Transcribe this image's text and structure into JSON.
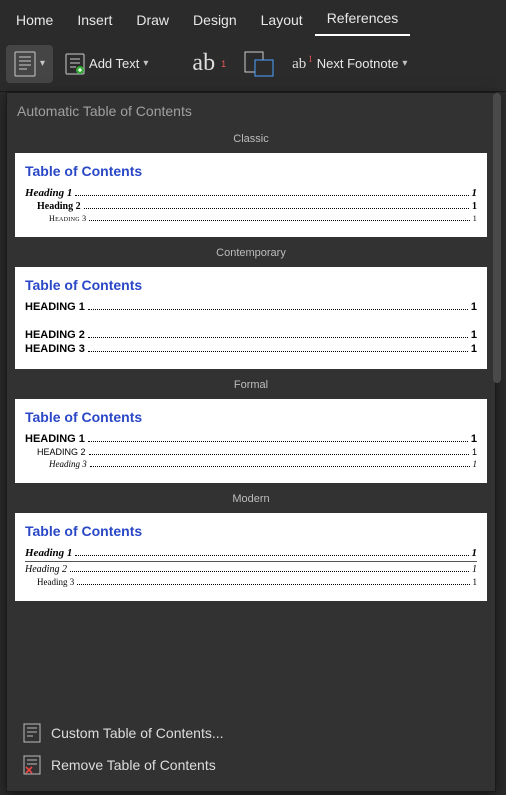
{
  "tabs": [
    "Home",
    "Insert",
    "Draw",
    "Design",
    "Layout",
    "References"
  ],
  "activeTab": "References",
  "ribbon": {
    "addText": "Add Text",
    "nextFootnote": "Next Footnote"
  },
  "dropdown": {
    "header": "Automatic Table of Contents",
    "styles": [
      {
        "name": "Classic",
        "title": "Table of Contents",
        "rows": [
          {
            "label": "Heading 1",
            "page": "1",
            "cls": "h1",
            "indent": 0
          },
          {
            "label": "Heading 2",
            "page": "1",
            "cls": "h2",
            "indent": 1
          },
          {
            "label": "Heading 3",
            "page": "1",
            "cls": "h3",
            "indent": 2
          }
        ]
      },
      {
        "name": "Contemporary",
        "title": "Table of Contents",
        "rows": [
          {
            "label": "HEADING 1",
            "page": "1",
            "cls": "h1",
            "indent": 0
          },
          {
            "gap": true
          },
          {
            "label": "HEADING 2",
            "page": "1",
            "cls": "h2",
            "indent": 0
          },
          {
            "label": "HEADING 3",
            "page": "1",
            "cls": "h3",
            "indent": 0
          }
        ]
      },
      {
        "name": "Formal",
        "title": "Table of Contents",
        "rows": [
          {
            "label": "HEADING 1",
            "page": "1",
            "cls": "h1",
            "indent": 0
          },
          {
            "label": "HEADING 2",
            "page": "1",
            "cls": "h2",
            "indent": 1
          },
          {
            "label": "Heading 3",
            "page": "1",
            "cls": "h3",
            "indent": 2
          }
        ]
      },
      {
        "name": "Modern",
        "title": "Table of Contents",
        "rows": [
          {
            "label": "Heading 1",
            "page": "1",
            "cls": "h1",
            "indent": 0
          },
          {
            "hr": true
          },
          {
            "label": "Heading 2",
            "page": "1",
            "cls": "h2",
            "indent": 0
          },
          {
            "label": "Heading 3",
            "page": "1",
            "cls": "h3",
            "indent": 1
          }
        ]
      }
    ],
    "footer": {
      "custom": "Custom Table of Contents...",
      "remove": "Remove Table of Contents"
    }
  }
}
